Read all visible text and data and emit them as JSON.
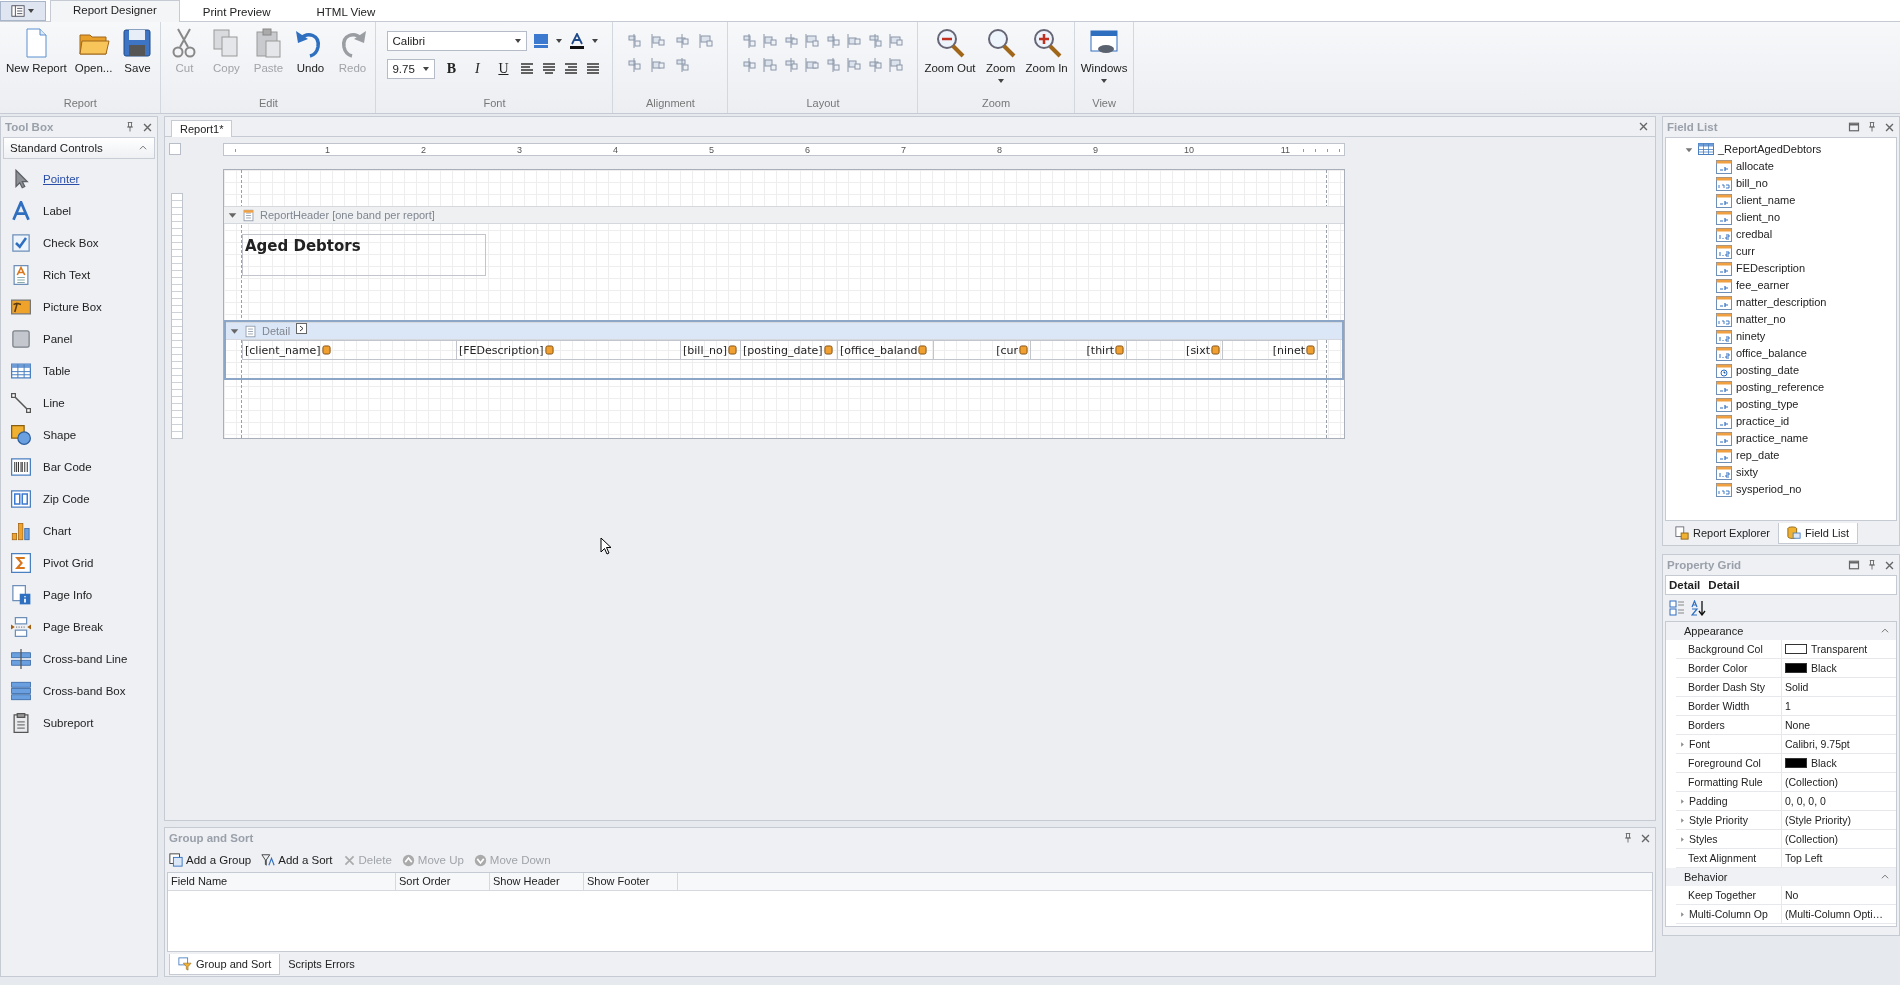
{
  "app_tabs": [
    {
      "label": "Report Designer",
      "selected": true
    },
    {
      "label": "Print Preview",
      "selected": false
    },
    {
      "label": "HTML View",
      "selected": false
    }
  ],
  "ribbon": {
    "groups": [
      {
        "kind": "buttons",
        "label": "Report",
        "buttons": [
          {
            "kind": "new",
            "label": "New Report",
            "disabled": false,
            "dropdown": false
          },
          {
            "kind": "open",
            "label": "Open...",
            "disabled": false,
            "dropdown": false
          },
          {
            "kind": "save",
            "label": "Save",
            "disabled": false,
            "dropdown": false
          }
        ]
      },
      {
        "kind": "buttons",
        "label": "Edit",
        "buttons": [
          {
            "kind": "cut",
            "label": "Cut",
            "disabled": true,
            "dropdown": false
          },
          {
            "kind": "copy",
            "label": "Copy",
            "disabled": true,
            "dropdown": false
          },
          {
            "kind": "paste",
            "label": "Paste",
            "disabled": true,
            "dropdown": false
          },
          {
            "kind": "undo",
            "label": "Undo",
            "disabled": false,
            "dropdown": false
          },
          {
            "kind": "redo",
            "label": "Redo",
            "disabled": true,
            "dropdown": false
          }
        ]
      },
      {
        "kind": "font",
        "label": "Font",
        "font_name": "Calibri",
        "font_size": "9.75",
        "style_buttons": [
          "B",
          "I",
          "U"
        ]
      },
      {
        "kind": "alignment",
        "label": "Alignment"
      },
      {
        "kind": "layout",
        "label": "Layout"
      },
      {
        "kind": "buttons",
        "label": "Zoom",
        "buttons": [
          {
            "kind": "zoom-out",
            "label": "Zoom Out",
            "disabled": false,
            "dropdown": false
          },
          {
            "kind": "zoom",
            "label": "Zoom",
            "disabled": false,
            "dropdown": true
          },
          {
            "kind": "zoom-in",
            "label": "Zoom In",
            "disabled": false,
            "dropdown": false
          }
        ]
      },
      {
        "kind": "buttons",
        "label": "View",
        "buttons": [
          {
            "kind": "windows",
            "label": "Windows",
            "disabled": false,
            "dropdown": true
          }
        ]
      }
    ]
  },
  "toolbox": {
    "title": "Tool Box",
    "category": {
      "label": "Standard Controls",
      "expanded": true
    },
    "items": [
      {
        "kind": "pointer",
        "label": "Pointer",
        "selected": true
      },
      {
        "kind": "label",
        "label": "Label",
        "selected": false
      },
      {
        "kind": "checkbox",
        "label": "Check Box",
        "selected": false
      },
      {
        "kind": "richtext",
        "label": "Rich Text",
        "selected": false
      },
      {
        "kind": "picture",
        "label": "Picture Box",
        "selected": false
      },
      {
        "kind": "panel",
        "label": "Panel",
        "selected": false
      },
      {
        "kind": "table",
        "label": "Table",
        "selected": false
      },
      {
        "kind": "line",
        "label": "Line",
        "selected": false
      },
      {
        "kind": "shape",
        "label": "Shape",
        "selected": false
      },
      {
        "kind": "barcode",
        "label": "Bar Code",
        "selected": false
      },
      {
        "kind": "zipcode",
        "label": "Zip Code",
        "selected": false
      },
      {
        "kind": "chart",
        "label": "Chart",
        "selected": false
      },
      {
        "kind": "pivot",
        "label": "Pivot Grid",
        "selected": false
      },
      {
        "kind": "pageinfo",
        "label": "Page Info",
        "selected": false
      },
      {
        "kind": "pagebreak",
        "label": "Page Break",
        "selected": false
      },
      {
        "kind": "crossline",
        "label": "Cross-band Line",
        "selected": false
      },
      {
        "kind": "crossbox",
        "label": "Cross-band Box",
        "selected": false
      },
      {
        "kind": "subreport",
        "label": "Subreport",
        "selected": false
      }
    ]
  },
  "document": {
    "tab": "Report1*",
    "ruler": [
      "1",
      "2",
      "3",
      "4",
      "5",
      "6",
      "7",
      "8",
      "9",
      "10",
      "11"
    ],
    "bands": [
      {
        "kind": "header",
        "title": "ReportHeader [one band per report]",
        "selected": false,
        "expanded": true,
        "label": "Aged Debtors"
      },
      {
        "kind": "detail",
        "title": "Detail",
        "selected": true,
        "expanded": true,
        "fields": [
          {
            "text": "[client_name]",
            "right_aligned": false
          },
          {
            "text": "[FEDescription]",
            "right_aligned": false
          },
          {
            "text": "[bill_no]",
            "right_aligned": false
          },
          {
            "text": "[posting_date]",
            "right_aligned": false
          },
          {
            "text": "[office_baland",
            "right_aligned": false
          },
          {
            "text": "[cur",
            "right_aligned": true
          },
          {
            "text": "[thirt",
            "right_aligned": true
          },
          {
            "text": "[sixt",
            "right_aligned": true
          },
          {
            "text": "[ninet",
            "right_aligned": true
          }
        ]
      }
    ]
  },
  "group_sort": {
    "title": "Group and Sort",
    "toolbar": [
      {
        "kind": "add-group",
        "label": "Add a Group",
        "disabled": false
      },
      {
        "kind": "add-sort",
        "label": "Add a Sort",
        "disabled": false
      },
      {
        "kind": "delete",
        "label": "Delete",
        "disabled": true
      },
      {
        "kind": "move-up",
        "label": "Move Up",
        "disabled": true
      },
      {
        "kind": "move-down",
        "label": "Move Down",
        "disabled": true
      }
    ],
    "columns": [
      "Field Name",
      "Sort Order",
      "Show Header",
      "Show Footer"
    ],
    "tabs": [
      {
        "label": "Group and Sort",
        "selected": true
      },
      {
        "label": "Scripts Errors",
        "selected": false
      }
    ]
  },
  "field_list": {
    "title": "Field List",
    "root": {
      "label": "_ReportAgedDebtors",
      "expanded": true
    },
    "fields": [
      {
        "name": "allocate",
        "kind": "string"
      },
      {
        "name": "bill_no",
        "kind": "integer"
      },
      {
        "name": "client_name",
        "kind": "string"
      },
      {
        "name": "client_no",
        "kind": "string"
      },
      {
        "name": "credbal",
        "kind": "decimal"
      },
      {
        "name": "curr",
        "kind": "decimal"
      },
      {
        "name": "FEDescription",
        "kind": "string"
      },
      {
        "name": "fee_earner",
        "kind": "string"
      },
      {
        "name": "matter_description",
        "kind": "string"
      },
      {
        "name": "matter_no",
        "kind": "integer"
      },
      {
        "name": "ninety",
        "kind": "decimal"
      },
      {
        "name": "office_balance",
        "kind": "decimal"
      },
      {
        "name": "posting_date",
        "kind": "date"
      },
      {
        "name": "posting_reference",
        "kind": "string"
      },
      {
        "name": "posting_type",
        "kind": "string"
      },
      {
        "name": "practice_id",
        "kind": "string"
      },
      {
        "name": "practice_name",
        "kind": "string"
      },
      {
        "name": "rep_date",
        "kind": "string"
      },
      {
        "name": "sixty",
        "kind": "decimal"
      },
      {
        "name": "sysperiod_no",
        "kind": "integer"
      }
    ],
    "tabs": [
      {
        "kind": "explorer",
        "label": "Report Explorer",
        "selected": false
      },
      {
        "kind": "fields",
        "label": "Field List",
        "selected": true
      }
    ]
  },
  "property_grid": {
    "title": "Property Grid",
    "object_name": "Detail",
    "object_type": "Detail",
    "categories": [
      {
        "name": "Appearance",
        "expanded": true,
        "rows": [
          {
            "name": "Background Col",
            "value": "Transparent",
            "expandable": false,
            "color": "#ffffff"
          },
          {
            "name": "Border Color",
            "value": "Black",
            "expandable": false,
            "color": "#000000"
          },
          {
            "name": "Border Dash Sty",
            "value": "Solid",
            "expandable": false
          },
          {
            "name": "Border Width",
            "value": "1",
            "expandable": false
          },
          {
            "name": "Borders",
            "value": "None",
            "expandable": false
          },
          {
            "name": "Font",
            "value": "Calibri, 9.75pt",
            "expandable": true
          },
          {
            "name": "Foreground Col",
            "value": "Black",
            "expandable": false,
            "color": "#000000"
          },
          {
            "name": "Formatting Rule",
            "value": "(Collection)",
            "expandable": false
          },
          {
            "name": "Padding",
            "value": "0, 0, 0, 0",
            "expandable": true
          },
          {
            "name": "Style Priority",
            "value": "(Style Priority)",
            "expandable": true
          },
          {
            "name": "Styles",
            "value": "(Collection)",
            "expandable": true
          },
          {
            "name": "Text Alignment",
            "value": "Top Left",
            "expandable": false
          }
        ]
      },
      {
        "name": "Behavior",
        "expanded": true,
        "rows": [
          {
            "name": "Keep Together",
            "value": "No",
            "expandable": false
          },
          {
            "name": "Multi-Column Op",
            "value": "(Multi-Column Opti…",
            "expandable": true
          }
        ]
      }
    ]
  }
}
